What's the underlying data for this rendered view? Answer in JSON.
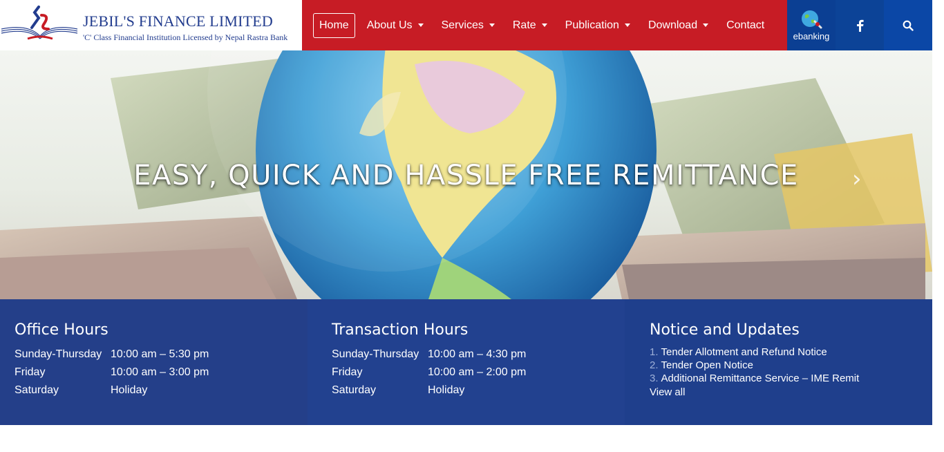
{
  "brand": {
    "name": "JEBIL'S FINANCE LIMITED",
    "tagline": "'C' Class Financial Institution Licensed by Nepal Rastra Bank"
  },
  "nav": {
    "items": [
      {
        "label": "Home",
        "active": true,
        "dropdown": false
      },
      {
        "label": "About Us",
        "dropdown": true
      },
      {
        "label": "Services",
        "dropdown": true
      },
      {
        "label": "Rate",
        "dropdown": true
      },
      {
        "label": "Publication",
        "dropdown": true
      },
      {
        "label": "Download",
        "dropdown": true
      },
      {
        "label": "Contact",
        "dropdown": false
      }
    ]
  },
  "utility": {
    "ebanking_label": "ebanking",
    "facebook_icon": "facebook-icon",
    "search_icon": "search-icon"
  },
  "hero": {
    "title": "EASY, QUICK AND HASSLE FREE REMITTANCE",
    "next_arrow": "›"
  },
  "office_hours": {
    "title": "Office Hours",
    "rows": [
      {
        "day": "Sunday-Thursday",
        "time": "10:00 am – 5:30 pm"
      },
      {
        "day": "Friday",
        "time": "10:00 am – 3:00 pm"
      },
      {
        "day": "Saturday",
        "time": "Holiday"
      }
    ]
  },
  "transaction_hours": {
    "title": "Transaction Hours",
    "rows": [
      {
        "day": "Sunday-Thursday",
        "time": "10:00 am – 4:30 pm"
      },
      {
        "day": "Friday",
        "time": "10:00 am – 2:00 pm"
      },
      {
        "day": "Saturday",
        "time": "Holiday"
      }
    ]
  },
  "notices": {
    "title": "Notice and Updates",
    "items": [
      {
        "num": "1.",
        "text": "Tender Allotment and Refund Notice"
      },
      {
        "num": "2.",
        "text": "Tender Open Notice"
      },
      {
        "num": "3.",
        "text": "Additional Remittance Service – IME Remit"
      }
    ],
    "view_all": "View all"
  },
  "colors": {
    "nav_red": "#c71c25",
    "brand_blue": "#223c8e",
    "panel_blue": "#243f89"
  }
}
